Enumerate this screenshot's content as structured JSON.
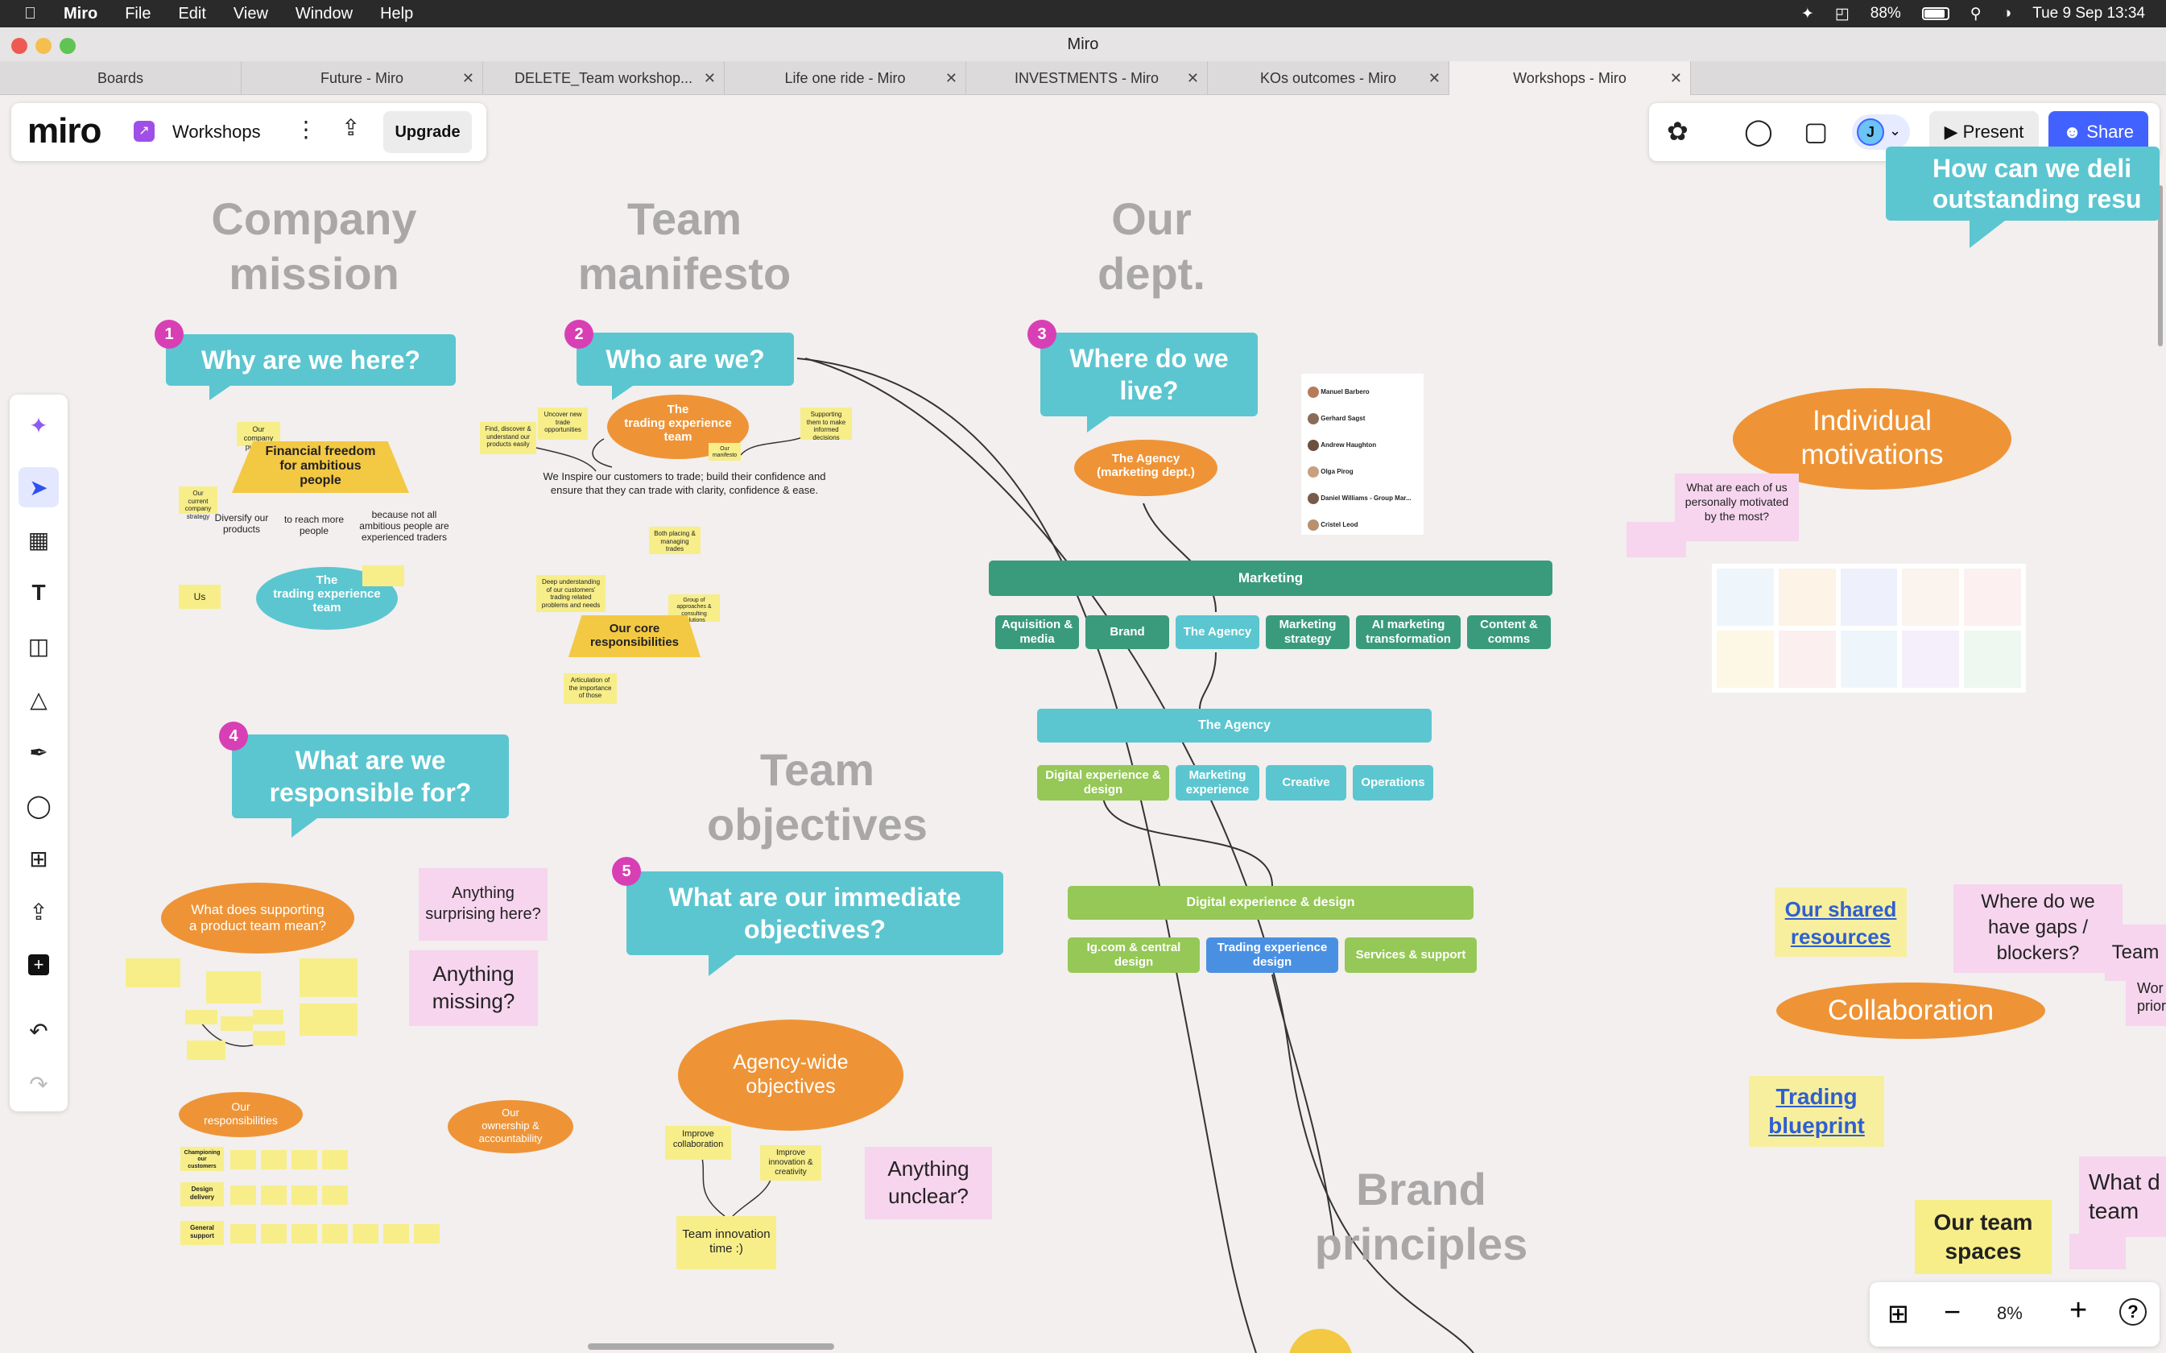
{
  "menubar": {
    "app": "Miro",
    "items": [
      "File",
      "Edit",
      "View",
      "Window",
      "Help"
    ],
    "battery": "88%",
    "datetime": "Tue 9 Sep  13:34"
  },
  "window": {
    "title": "Miro"
  },
  "tabs": [
    {
      "label": "Boards"
    },
    {
      "label": "Future - Miro"
    },
    {
      "label": "DELETE_Team workshop..."
    },
    {
      "label": "Life one ride - Miro"
    },
    {
      "label": "INVESTMENTS - Miro"
    },
    {
      "label": "KOs outcomes - Miro"
    },
    {
      "label": "Workshops - Miro"
    }
  ],
  "board": {
    "logo": "miro",
    "name": "Workshops",
    "upgrade": "Upgrade"
  },
  "topright": {
    "avatar": "J",
    "present": "Present",
    "share": "Share"
  },
  "zoom": {
    "level": "8%"
  },
  "colors": {
    "accent": "#4262ff",
    "cyan": "#5bc6d0",
    "orange": "#ee9437",
    "pink": "#d93fb4"
  },
  "canvas": {
    "h_mission": [
      "Company",
      "mission"
    ],
    "h_manifesto": [
      "Team",
      "manifesto"
    ],
    "h_dept": [
      "Our",
      "dept."
    ],
    "h_objectives": [
      "Team",
      "objectives"
    ],
    "h_brand": [
      "Brand",
      "principles"
    ],
    "q1": "Why are we here?",
    "q2": "Who are we?",
    "q3": [
      "Where do we",
      "live?"
    ],
    "q4": [
      "What are we",
      "responsible for?"
    ],
    "q5": [
      "What are our immediate",
      "objectives?"
    ],
    "n": [
      "1",
      "2",
      "3",
      "4",
      "5"
    ],
    "how": [
      "How can we deli",
      "outstanding resu"
    ],
    "mission": {
      "purpose": "Our company purpose",
      "freedom": [
        "Financial freedom",
        "for ambitious",
        "people"
      ],
      "strategy": "Our current company strategy",
      "diversify": [
        "Diversify our",
        "products"
      ],
      "reach": [
        "to reach more",
        "people"
      ],
      "because": [
        "because not all",
        "ambitious people are",
        "experienced traders"
      ],
      "us": "Us",
      "team": [
        "The",
        "trading experience",
        "team"
      ]
    },
    "manifesto": {
      "team": [
        "The",
        "trading experience",
        "team"
      ],
      "find": "Find, discover & understand our products easily",
      "uncover": "Uncover new trade opportunities",
      "support": "Supporting them to make informed decisions",
      "our": "Our manifesto",
      "inspire1": "We Inspire our customers to trade; build their confidence and",
      "inspire2": "ensure that they can trade with clarity, confidence & ease.",
      "both": "Both placing & managing trades",
      "deep": "Deep understanding of our customers' trading related problems and needs",
      "core": [
        "Our core",
        "responsibilities"
      ],
      "articulation": "Articulation of the importance of those",
      "gr": "Group of approaches & consulting solutions"
    },
    "dept": {
      "agency_cloud": [
        "The Agency",
        "(marketing dept.)"
      ],
      "marketing": "Marketing",
      "row1": [
        "Aquisition & media",
        "Brand",
        "The Agency",
        "Marketing strategy",
        "AI marketing transformation",
        "Content & comms"
      ],
      "agency": "The Agency",
      "row2": [
        "Digital experience & design",
        "Marketing experience",
        "Creative",
        "Operations"
      ],
      "digital": "Digital experience & design",
      "row3": [
        "Ig.com & central design",
        "Trading experience design",
        "Services & support"
      ]
    },
    "people": [
      "Manuel Barbero",
      "Gerhard Sagst",
      "Andrew Haughton",
      "Olga Pirog",
      "Daniel Williams - Group Mar...",
      "Cristel Leod"
    ],
    "resp": {
      "supporting": [
        "What does supporting",
        "a product team mean?"
      ],
      "surprising": [
        "Anything",
        "surprising here?"
      ],
      "missing": [
        "Anything",
        "missing?"
      ],
      "ourresp": [
        "Our",
        "responsibilities"
      ],
      "ownership": [
        "Our",
        "ownership &",
        "accountability"
      ],
      "rows": [
        "Championing our customers",
        "Design delivery",
        "General support"
      ]
    },
    "obj": {
      "agency": [
        "Agency-wide",
        "objectives"
      ],
      "improve1": "Improve collaboration",
      "improve2": "Improve innovation & creativity",
      "innovation": "Team innovation time :)",
      "unclear": [
        "Anything",
        "unclear?"
      ]
    },
    "right": {
      "motivations": [
        "Individual",
        "motivations"
      ],
      "whatare": "What are each of us personally motivated by the most?",
      "shared": [
        "Our shared",
        "resources"
      ],
      "gaps": [
        "Where do we",
        "have gaps /",
        "blockers?"
      ],
      "teamcut": "Team",
      "work": [
        "Wor",
        "prior"
      ],
      "collab": "Collaboration",
      "trading": [
        "Trading",
        "blueprint"
      ],
      "spaces": [
        "Our team",
        "spaces"
      ],
      "whatd": [
        "What d",
        "team"
      ]
    }
  }
}
